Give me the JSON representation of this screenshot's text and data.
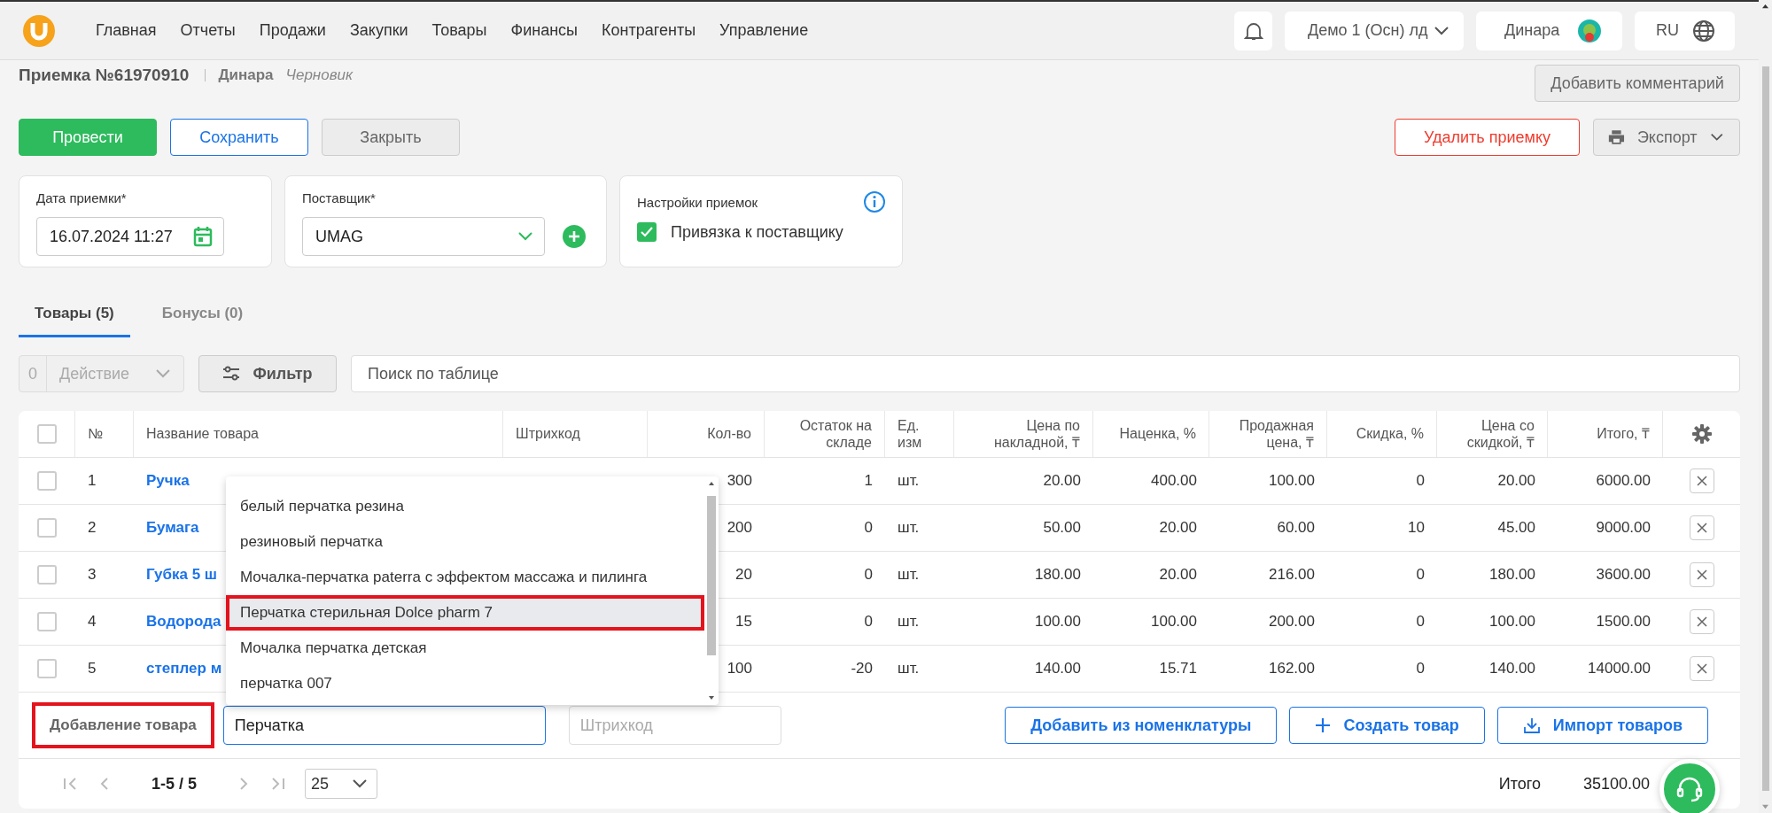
{
  "nav": {
    "items": [
      "Главная",
      "Отчеты",
      "Продажи",
      "Закупки",
      "Товары",
      "Финансы",
      "Контрагенты",
      "Управление"
    ]
  },
  "header": {
    "company": "Демо 1 (Осн) лд",
    "user": "Динара",
    "language": "RU"
  },
  "document": {
    "title": "Приемка №61970910",
    "author": "Динара",
    "status": "Черновик",
    "comment_button": "Добавить комментарий"
  },
  "actions": {
    "buttons": [
      {
        "label": "Провести",
        "kind": "primary"
      },
      {
        "label": "Сохранить",
        "kind": "outline"
      },
      {
        "label": "Закрыть",
        "kind": "secondary"
      }
    ],
    "delete": "Удалить приемку",
    "export": "Экспорт"
  },
  "date_card": {
    "label": "Дата приемки*",
    "value": "16.07.2024 11:27"
  },
  "supplier_card": {
    "label": "Поставщик*",
    "value": "UMAG"
  },
  "settings_card": {
    "title": "Настройки приемок",
    "checkbox": {
      "label": "Привязка к поставщику",
      "checked": true
    }
  },
  "tabs": [
    {
      "label": "Товары (5)",
      "selected": true
    },
    {
      "label": "Бонусы (0)",
      "selected": false
    }
  ],
  "toolbar": {
    "selected_count": "0",
    "action": "Действие",
    "filter": "Фильтр",
    "search_placeholder": "Поиск по таблице"
  },
  "table": {
    "select_all_checked": false,
    "columns": [
      "№",
      "Название товара",
      "Штрихкод",
      "Кол-во",
      "Остаток на складе",
      "Ед. изм",
      "Цена по накладной, ₸",
      "Наценка, %",
      "Продажная цена, ₸",
      "Скидка, %",
      "Цена со скидкой, ₸",
      "Итого, ₸"
    ],
    "rows": [
      {
        "checked": false,
        "cells": [
          "1",
          "Ручка",
          "",
          "300",
          "1",
          "шт.",
          "20.00",
          "400.00",
          "100.00",
          "0",
          "20.00",
          "6000.00"
        ]
      },
      {
        "checked": false,
        "cells": [
          "2",
          "Бумага",
          "",
          "200",
          "0",
          "шт.",
          "50.00",
          "20.00",
          "60.00",
          "10",
          "45.00",
          "9000.00"
        ]
      },
      {
        "checked": false,
        "cells": [
          "3",
          "Губка 5 ш",
          "",
          "20",
          "0",
          "шт.",
          "180.00",
          "20.00",
          "216.00",
          "0",
          "180.00",
          "3600.00"
        ]
      },
      {
        "checked": false,
        "cells": [
          "4",
          "Водорода",
          "",
          "15",
          "0",
          "шт.",
          "100.00",
          "100.00",
          "200.00",
          "0",
          "100.00",
          "1500.00"
        ]
      },
      {
        "checked": false,
        "cells": [
          "5",
          "степлер м",
          "",
          "100",
          "-20",
          "шт.",
          "140.00",
          "15.71",
          "162.00",
          "0",
          "140.00",
          "14000.00"
        ]
      }
    ]
  },
  "dropdown": {
    "items": [
      {
        "label": "белый перчатка резина",
        "selected": false
      },
      {
        "label": "резиновый перчатка",
        "selected": false
      },
      {
        "label": "Мочалка-перчатка paterra с эффектом массажа и пилинга",
        "selected": false
      },
      {
        "label": "Перчатка стерильная Dolce pharm 7",
        "selected": true
      },
      {
        "label": "Мочалка перчатка детская",
        "selected": false
      },
      {
        "label": "перчатка 007",
        "selected": false
      }
    ]
  },
  "add_row": {
    "label": "Добавление товара",
    "highlighted": true,
    "value": "Перчатка",
    "barcode_placeholder": "Штрихкод",
    "buttons": [
      {
        "label": "Добавить из номенклатуры",
        "kind": "text"
      },
      {
        "label": "Создать товар",
        "kind": "create"
      },
      {
        "label": "Импорт товаров",
        "kind": "import"
      }
    ]
  },
  "pagination": {
    "range": "1-5 / 5",
    "page_size": "25"
  },
  "total": {
    "label": "Итого",
    "value": "35100.00"
  }
}
